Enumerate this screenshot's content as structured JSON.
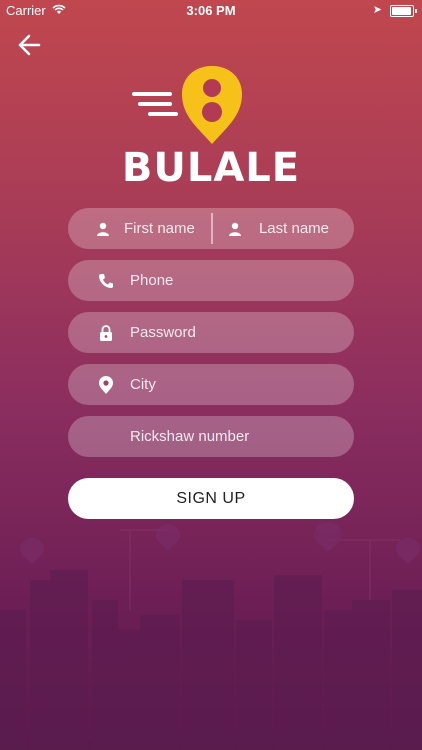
{
  "status_bar": {
    "carrier": "Carrier",
    "time": "3:06 PM"
  },
  "brand": {
    "name": "BULALE",
    "accent": "#F6C21A"
  },
  "form": {
    "first_name_placeholder": "First name",
    "last_name_placeholder": "Last name",
    "phone_placeholder": "Phone",
    "password_placeholder": "Password",
    "city_placeholder": "City",
    "rickshaw_placeholder": "Rickshaw number",
    "signup_label": "SIGN UP"
  },
  "icons": {
    "back": "arrow-left-icon",
    "person": "person-icon",
    "phone": "phone-icon",
    "lock": "lock-icon",
    "location": "location-pin-icon"
  }
}
